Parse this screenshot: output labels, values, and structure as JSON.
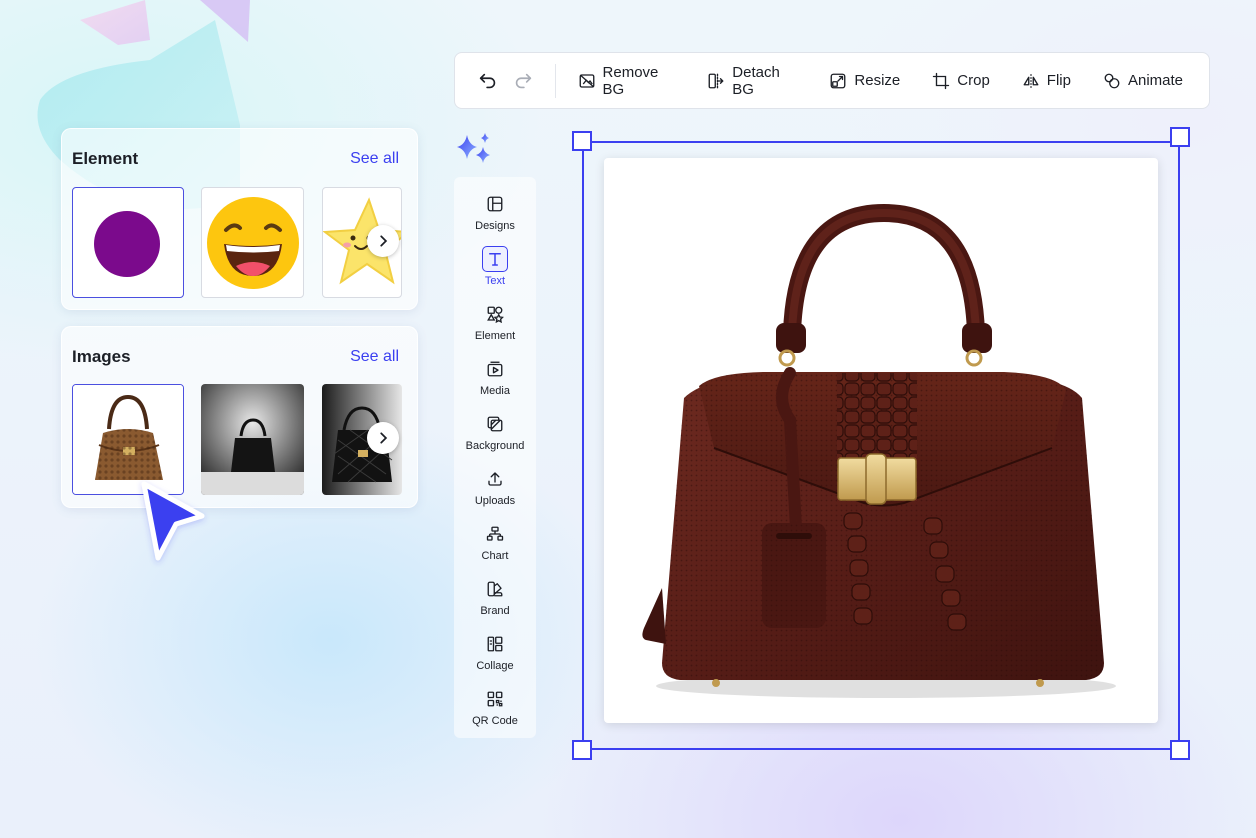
{
  "toolbar": {
    "undo_icon": "undo-icon",
    "redo_icon": "redo-icon",
    "buttons": [
      {
        "label": "Remove BG",
        "icon": "remove-bg-icon"
      },
      {
        "label": "Detach BG",
        "icon": "detach-bg-icon"
      },
      {
        "label": "Resize",
        "icon": "resize-icon"
      },
      {
        "label": "Crop",
        "icon": "crop-icon"
      },
      {
        "label": "Flip",
        "icon": "flip-icon"
      },
      {
        "label": "Animate",
        "icon": "animate-icon"
      }
    ]
  },
  "element_panel": {
    "title": "Element",
    "see_all": "See all",
    "items": [
      "purple-circle",
      "laughing-emoji",
      "smiling-star"
    ]
  },
  "images_panel": {
    "title": "Images",
    "see_all": "See all",
    "items": [
      "brown-snakeskin-handbag",
      "black-handbag-spotlight",
      "black-quilted-handbag"
    ]
  },
  "sidebar": {
    "items": [
      {
        "label": "Designs",
        "icon": "designs-icon"
      },
      {
        "label": "Text",
        "icon": "text-icon",
        "active": true
      },
      {
        "label": "Element",
        "icon": "element-icon"
      },
      {
        "label": "Media",
        "icon": "media-icon"
      },
      {
        "label": "Background",
        "icon": "background-icon"
      },
      {
        "label": "Uploads",
        "icon": "upload-icon"
      },
      {
        "label": "Chart",
        "icon": "chart-icon"
      },
      {
        "label": "Brand",
        "icon": "brand-icon"
      },
      {
        "label": "Collage",
        "icon": "collage-icon"
      },
      {
        "label": "QR Code",
        "icon": "qr-code-icon"
      }
    ]
  },
  "colors": {
    "accent": "#3b3ff0",
    "handbag": "#5a1f18"
  }
}
